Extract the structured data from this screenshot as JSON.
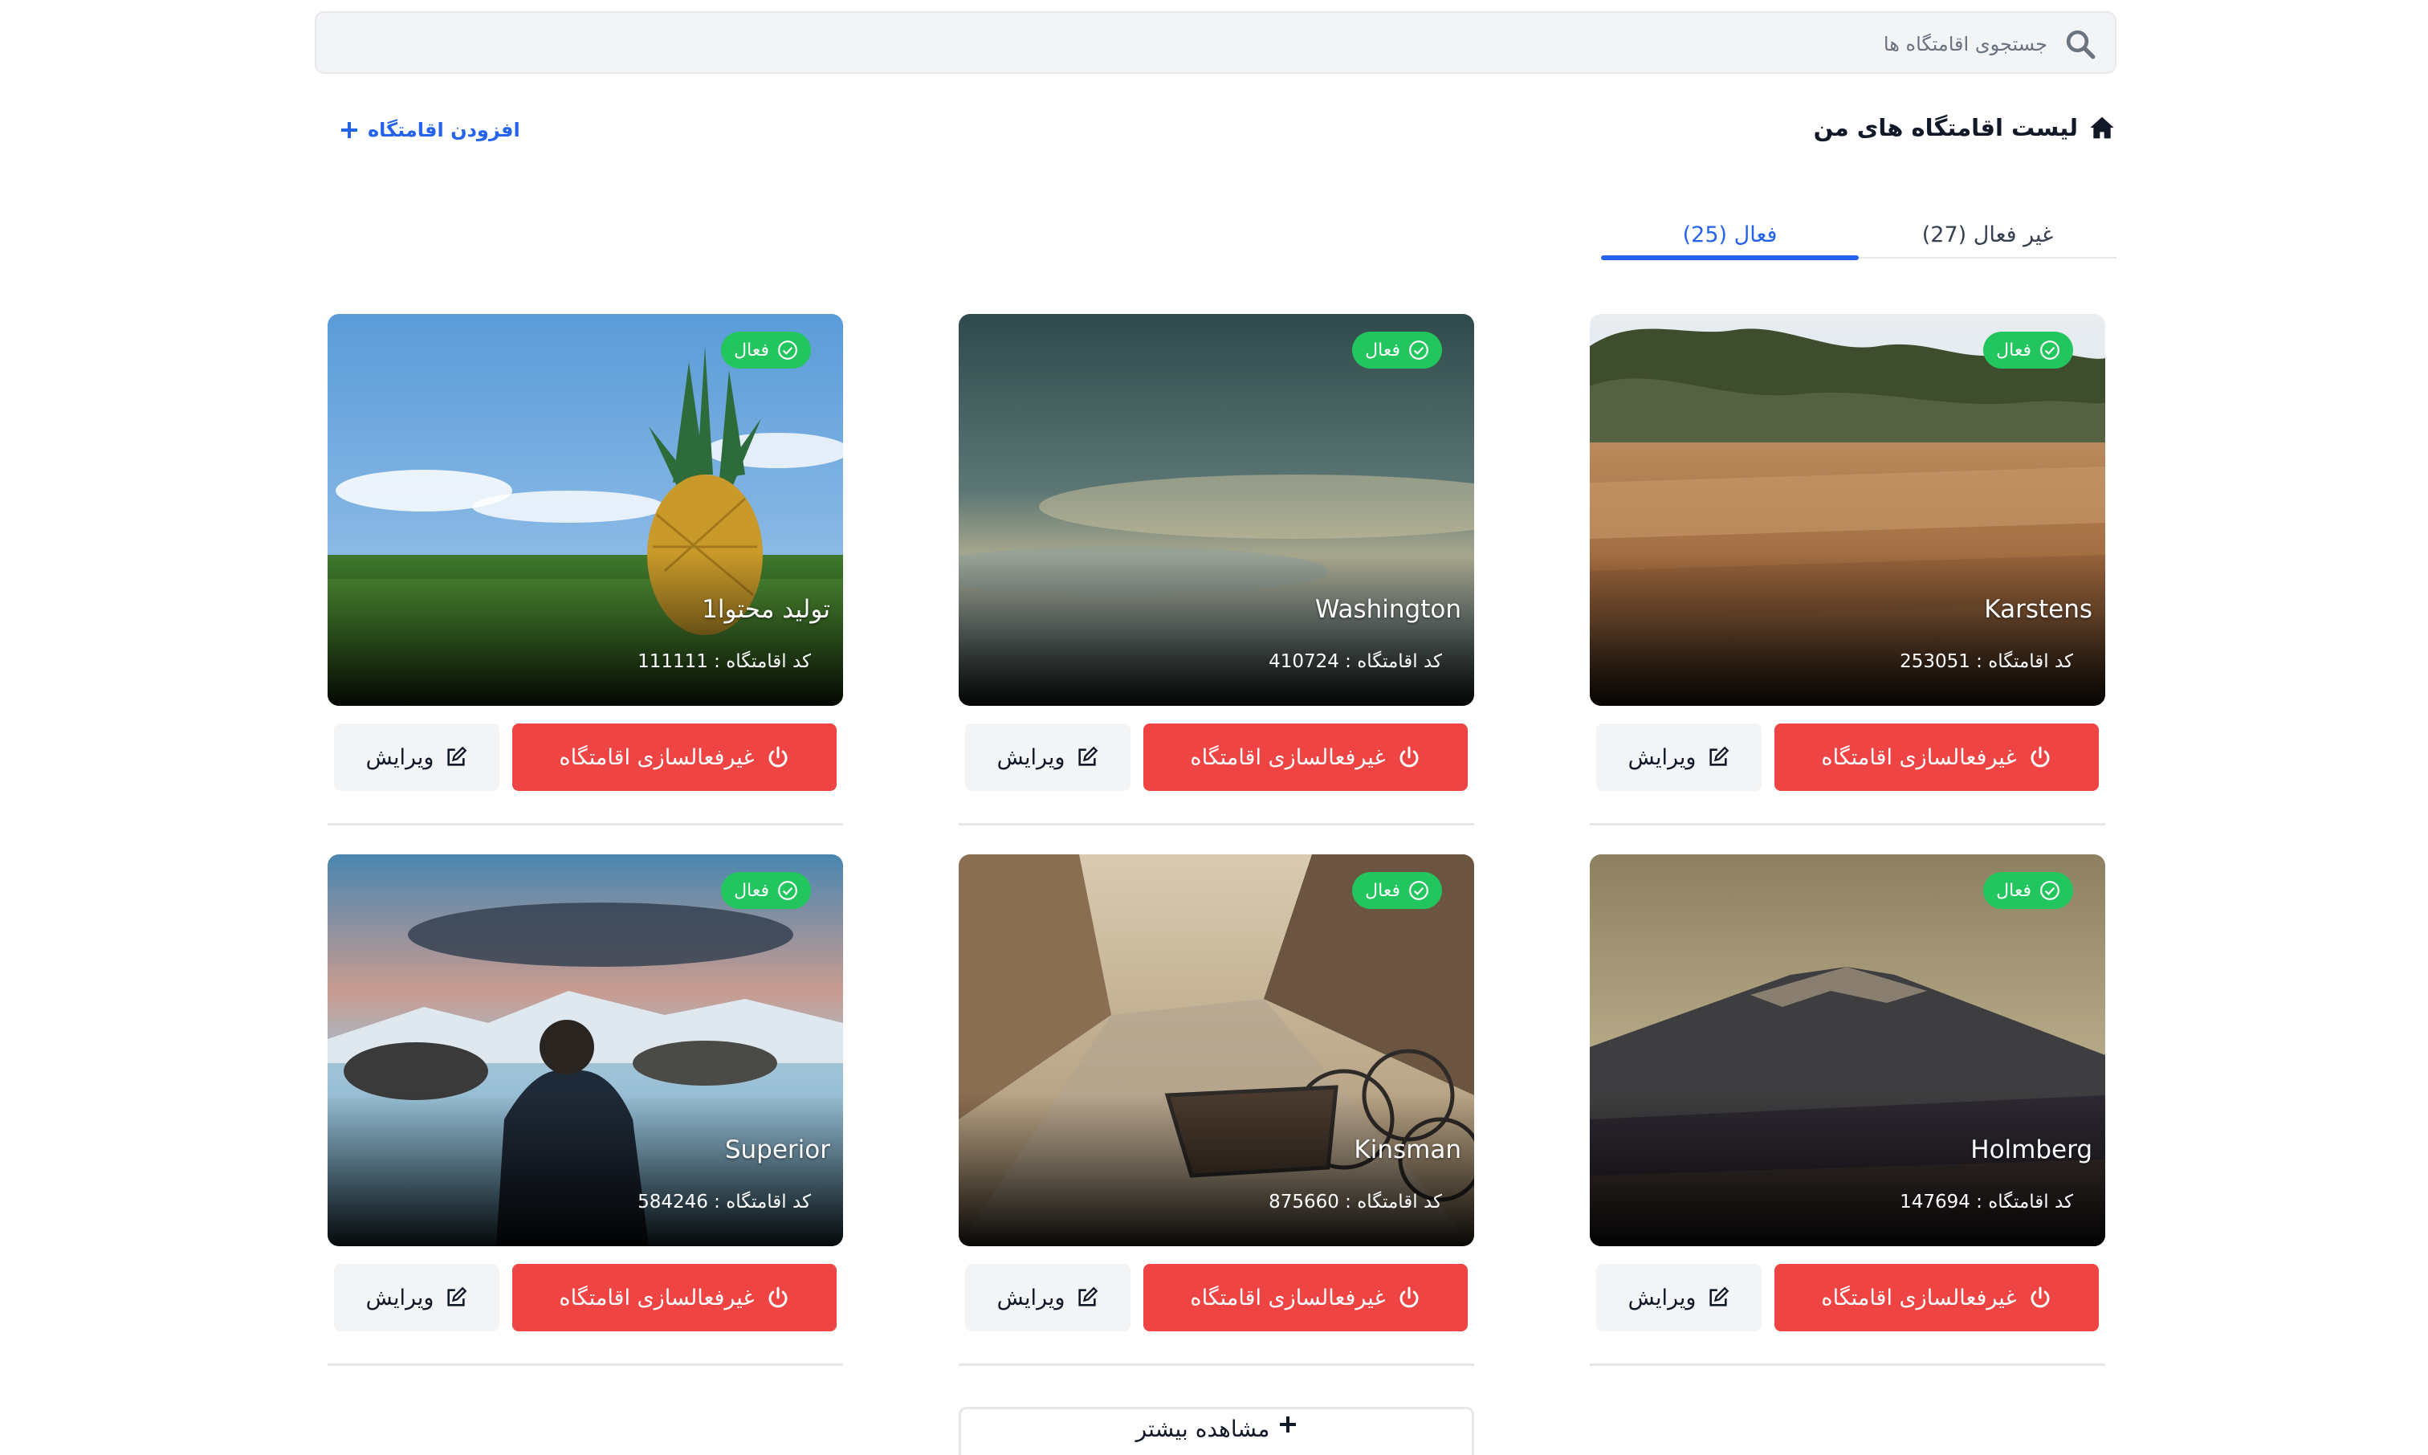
{
  "search": {
    "placeholder": "جستجوی اقامتگاه ها"
  },
  "header": {
    "title": "لیست اقامتگاه های من",
    "add_label": "افزودن اقامتگاه"
  },
  "tabs": [
    {
      "label": "غیر فعال (27)",
      "active": false
    },
    {
      "label": "فعال (25)",
      "active": true
    }
  ],
  "cards": [
    {
      "name": "Karstens",
      "code_label": "کد اقامتگاه : 253051",
      "status": "فعال",
      "deactivate_label": "غیرفعالسازی اقامتگاه",
      "edit_label": "ویرایش",
      "image_icon": "wheat-field-photo"
    },
    {
      "name": "Washington",
      "code_label": "کد اقامتگاه : 410724",
      "status": "فعال",
      "deactivate_label": "غیرفعالسازی اقامتگاه",
      "edit_label": "ویرایش",
      "image_icon": "cloudy-sky-photo"
    },
    {
      "name": "تولید محتوا1",
      "code_label": "کد اقامتگاه : 111111",
      "status": "فعال",
      "deactivate_label": "غیرفعالسازی اقامتگاه",
      "edit_label": "ویرایش",
      "image_icon": "pineapple-photo"
    },
    {
      "name": "Holmberg",
      "code_label": "کد اقامتگاه : 147694",
      "status": "فعال",
      "deactivate_label": "غیرفعالسازی اقامتگاه",
      "edit_label": "ویرایش",
      "image_icon": "mountain-photo"
    },
    {
      "name": "Kinsman",
      "code_label": "کد اقامتگاه : 875660",
      "status": "فعال",
      "deactivate_label": "غیرفعالسازی اقامتگاه",
      "edit_label": "ویرایش",
      "image_icon": "street-bicycles-photo"
    },
    {
      "name": "Superior",
      "code_label": "کد اقامتگاه : 584246",
      "status": "فعال",
      "deactivate_label": "غیرفعالسازی اقامتگاه",
      "edit_label": "ویرایش",
      "image_icon": "lake-man-photo"
    }
  ],
  "footer": {
    "more_label": "مشاهده بیشتر"
  },
  "colors": {
    "accent": "#2563eb",
    "danger": "#ef4444",
    "success": "#22c55e"
  }
}
